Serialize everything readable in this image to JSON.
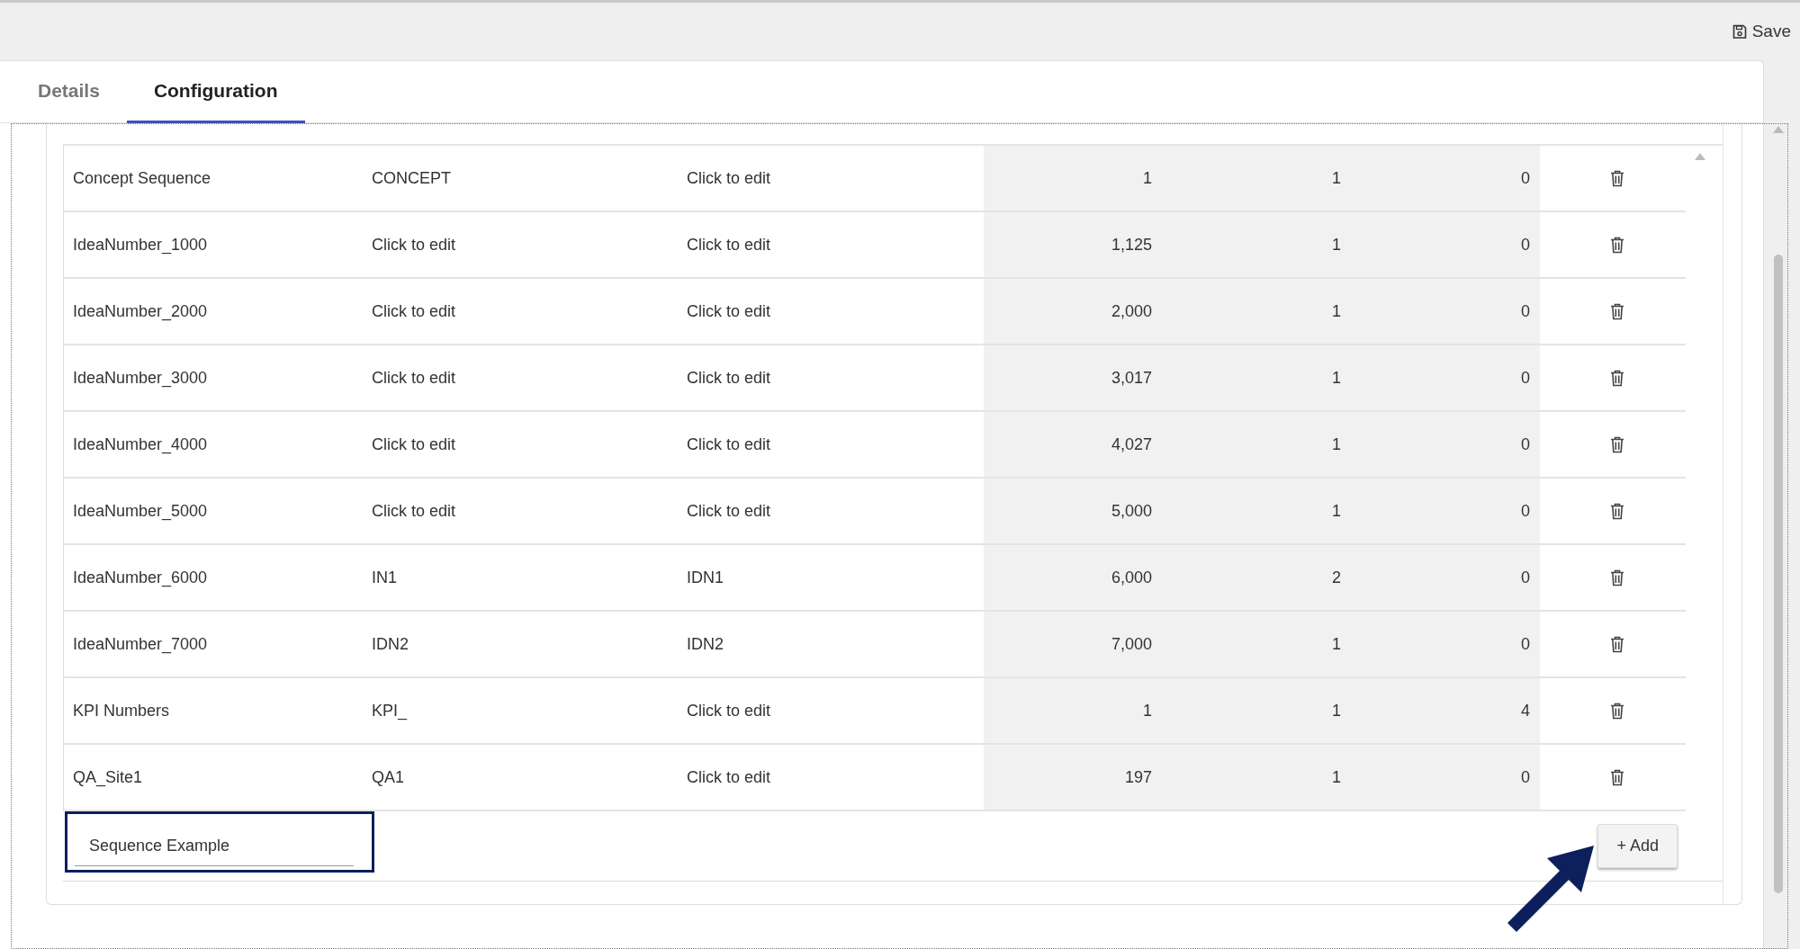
{
  "toolbar": {
    "save_label": "Save"
  },
  "tabs": [
    {
      "label": "Details",
      "selected": false
    },
    {
      "label": "Configuration",
      "selected": true
    }
  ],
  "table": {
    "rows": [
      {
        "column_1": "Concept Sequence",
        "column_2": "CONCEPT",
        "column_3": "Click to edit",
        "column_4": "1",
        "column_5": "1",
        "column_6": "0"
      },
      {
        "column_1": "IdeaNumber_1000",
        "column_2": "Click to edit",
        "column_3": "Click to edit",
        "column_4": "1,125",
        "column_5": "1",
        "column_6": "0"
      },
      {
        "column_1": "IdeaNumber_2000",
        "column_2": "Click to edit",
        "column_3": "Click to edit",
        "column_4": "2,000",
        "column_5": "1",
        "column_6": "0"
      },
      {
        "column_1": "IdeaNumber_3000",
        "column_2": "Click to edit",
        "column_3": "Click to edit",
        "column_4": "3,017",
        "column_5": "1",
        "column_6": "0"
      },
      {
        "column_1": "IdeaNumber_4000",
        "column_2": "Click to edit",
        "column_3": "Click to edit",
        "column_4": "4,027",
        "column_5": "1",
        "column_6": "0"
      },
      {
        "column_1": "IdeaNumber_5000",
        "column_2": "Click to edit",
        "column_3": "Click to edit",
        "column_4": "5,000",
        "column_5": "1",
        "column_6": "0"
      },
      {
        "column_1": "IdeaNumber_6000",
        "column_2": "IN1",
        "column_3": "IDN1",
        "column_4": "6,000",
        "column_5": "2",
        "column_6": "0"
      },
      {
        "column_1": "IdeaNumber_7000",
        "column_2": "IDN2",
        "column_3": "IDN2",
        "column_4": "7,000",
        "column_5": "1",
        "column_6": "0"
      },
      {
        "column_1": "KPI Numbers",
        "column_2": "KPI_",
        "column_3": "Click to edit",
        "column_4": "1",
        "column_5": "1",
        "column_6": "4"
      },
      {
        "column_1": "QA_Site1",
        "column_2": "QA1",
        "column_3": "Click to edit",
        "column_4": "197",
        "column_5": "1",
        "column_6": "0"
      }
    ]
  },
  "new_entry": {
    "value": "Sequence Example",
    "add_label": "+ Add"
  }
}
